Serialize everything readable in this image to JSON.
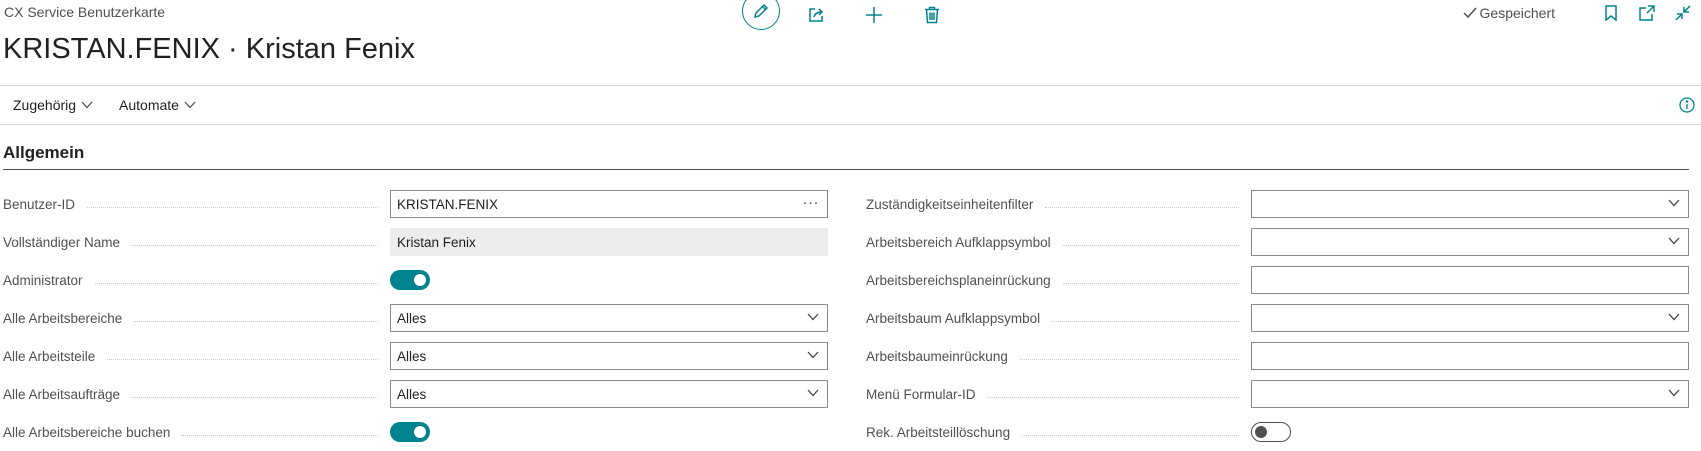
{
  "page": {
    "caption": "CX Service Benutzerkarte",
    "title": "KRISTAN.FENIX · Kristan Fenix",
    "saved_status": "Gespeichert"
  },
  "toolbar": {
    "icons": [
      "edit-icon",
      "share-icon",
      "add-icon",
      "delete-icon"
    ],
    "right_icons": [
      "bookmark-icon",
      "open-new-window-icon",
      "collapse-icon"
    ]
  },
  "action_bar": {
    "menus": [
      {
        "label": "Zugehörig"
      },
      {
        "label": "Automate"
      }
    ]
  },
  "section": {
    "title": "Allgemein"
  },
  "left_fields": [
    {
      "label": "Benutzer-ID",
      "type": "text-lookup",
      "value": "KRISTAN.FENIX"
    },
    {
      "label": "Vollständiger Name",
      "type": "readonly",
      "value": "Kristan Fenix"
    },
    {
      "label": "Administrator",
      "type": "toggle",
      "checked": true
    },
    {
      "label": "Alle Arbeitsbereiche",
      "type": "select",
      "value": "Alles"
    },
    {
      "label": "Alle Arbeitsteile",
      "type": "select",
      "value": "Alles"
    },
    {
      "label": "Alle Arbeitsaufträge",
      "type": "select",
      "value": "Alles"
    },
    {
      "label": "Alle Arbeitsbereiche buchen",
      "type": "toggle",
      "checked": true
    }
  ],
  "right_fields": [
    {
      "label": "Zuständigkeitseinheitenfilter",
      "type": "select",
      "value": ""
    },
    {
      "label": "Arbeitsbereich Aufklappsymbol",
      "type": "select",
      "value": ""
    },
    {
      "label": "Arbeitsbereichsplaneinrückung",
      "type": "text",
      "value": ""
    },
    {
      "label": "Arbeitsbaum Aufklappsymbol",
      "type": "select",
      "value": ""
    },
    {
      "label": "Arbeitsbaumeinrückung",
      "type": "text",
      "value": ""
    },
    {
      "label": "Menü Formular-ID",
      "type": "select",
      "value": ""
    },
    {
      "label": "Rek. Arbeitsteillöschung",
      "type": "toggle",
      "checked": false
    }
  ],
  "colors": {
    "accent": "#00838f",
    "text": "#212121",
    "label": "#505050",
    "readonly_bg": "#ececec"
  }
}
